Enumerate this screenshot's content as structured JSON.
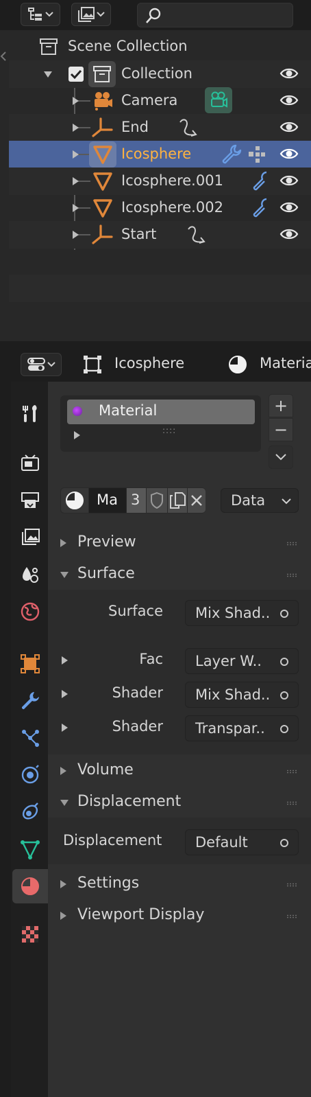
{
  "outliner": {
    "scene_collection": "Scene Collection",
    "items": [
      {
        "label": "Collection"
      },
      {
        "label": "Camera"
      },
      {
        "label": "End"
      },
      {
        "label": "Icosphere"
      },
      {
        "label": "Icosphere.001"
      },
      {
        "label": "Icosphere.002"
      },
      {
        "label": "Start"
      }
    ]
  },
  "properties": {
    "header": {
      "object_name": "Icosphere",
      "context_label": "Materia"
    },
    "material_slot": "Material",
    "list_grip": "::::",
    "material_browser": {
      "name": "Ma",
      "users": "3",
      "link_label": "Data"
    },
    "panels": {
      "preview": "Preview",
      "surface": "Surface",
      "volume": "Volume",
      "displacement": "Displacement",
      "settings": "Settings",
      "viewport_display": "Viewport Display"
    },
    "surface_props": [
      {
        "label": "Surface",
        "value": "Mix Shad.."
      },
      {
        "label": "Fac",
        "value": "Layer W.."
      },
      {
        "label": "Shader",
        "value": "Mix Shad.."
      },
      {
        "label": "Shader",
        "value": "Transpar.."
      }
    ],
    "displacement_prop": {
      "label": "Displacement",
      "value": "Default"
    }
  },
  "colors": {
    "selected_row": "#4b649c",
    "object_orange": "#e0873a",
    "selected_text": "#ffb340",
    "camera_green": "#27c09a",
    "modifier_blue": "#6a9ee6"
  }
}
